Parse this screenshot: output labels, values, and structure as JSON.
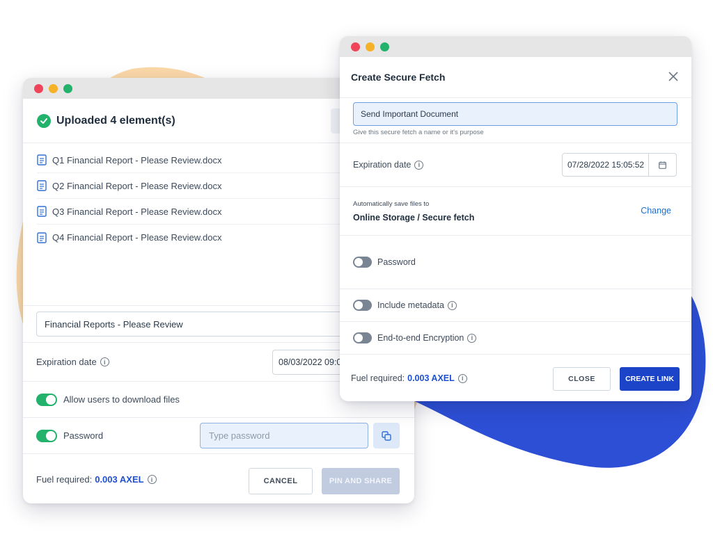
{
  "colors": {
    "accent_blue": "#1c4fd1",
    "success_green": "#23b26b",
    "blob_orange": "#fbd8a8",
    "blob_blue": "#2d4fd6"
  },
  "back_window": {
    "header": {
      "title": "Uploaded 4 element(s)",
      "icon": "check-circle-icon"
    },
    "files": [
      {
        "name": "Q1 Financial Report - Please Review.docx",
        "icon": "document-icon"
      },
      {
        "name": "Q2 Financial Report - Please Review.docx",
        "icon": "document-icon"
      },
      {
        "name": "Q3 Financial Report - Please Review.docx",
        "icon": "document-icon"
      },
      {
        "name": "Q4 Financial Report - Please Review.docx",
        "icon": "document-icon"
      }
    ],
    "name_field": {
      "value": "Financial Reports - Please Review"
    },
    "expiration": {
      "label": "Expiration date",
      "value": "08/03/2022 09:0"
    },
    "allow_download": {
      "label": "Allow users to download files",
      "enabled": true
    },
    "password": {
      "label": "Password",
      "enabled": true,
      "placeholder": "Type password"
    },
    "footer": {
      "fuel_label": "Fuel required:",
      "fuel_value": "0.003 AXEL",
      "cancel_label": "CANCEL",
      "pin_label": "PIN AND SHARE"
    }
  },
  "front_window": {
    "title": "Create Secure Fetch",
    "fetch_name": {
      "value": "Send Important Document",
      "help": "Give this secure fetch a name or it's purpose"
    },
    "expiration": {
      "label": "Expiration date",
      "value": "07/28/2022 15:05:52"
    },
    "storage": {
      "label": "Automatically save files to",
      "value": "Online Storage / Secure fetch",
      "change_label": "Change"
    },
    "toggles": [
      {
        "label": "Password",
        "enabled": false
      },
      {
        "label": "Include metadata",
        "enabled": false
      },
      {
        "label": "End-to-end Encryption",
        "enabled": false
      }
    ],
    "footer": {
      "fuel_label": "Fuel required:",
      "fuel_value": "0.003 AXEL",
      "close_label": "CLOSE",
      "create_label": "CREATE LINK"
    }
  }
}
